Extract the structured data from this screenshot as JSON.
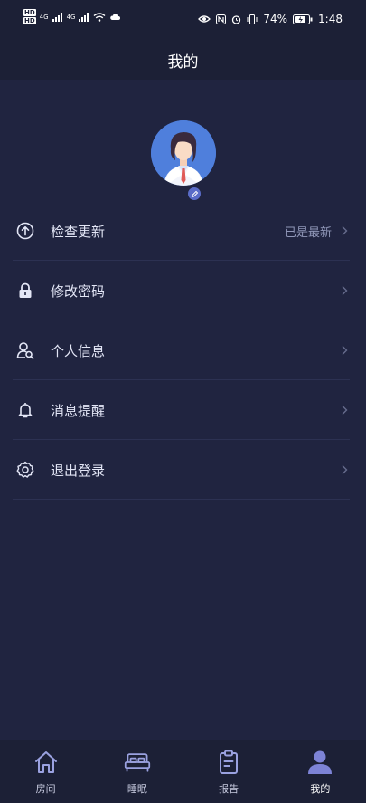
{
  "status_bar": {
    "hd1": "HD",
    "hd2": "HD",
    "net1": "4G",
    "net2": "4G",
    "battery": "74%",
    "time": "1:48"
  },
  "header": {
    "title": "我的"
  },
  "menu": {
    "items": [
      {
        "label": "检查更新",
        "extra": "已是最新",
        "icon": "arrow-up-circle-icon"
      },
      {
        "label": "修改密码",
        "extra": "",
        "icon": "lock-icon"
      },
      {
        "label": "个人信息",
        "extra": "",
        "icon": "person-search-icon"
      },
      {
        "label": "消息提醒",
        "extra": "",
        "icon": "bell-icon"
      },
      {
        "label": "退出登录",
        "extra": "",
        "icon": "gear-icon"
      }
    ]
  },
  "tabs": [
    {
      "label": "房间",
      "icon": "home-icon",
      "active": false
    },
    {
      "label": "睡眠",
      "icon": "bed-icon",
      "active": false
    },
    {
      "label": "报告",
      "icon": "clipboard-icon",
      "active": false
    },
    {
      "label": "我的",
      "icon": "user-icon",
      "active": true
    }
  ],
  "colors": {
    "background": "#202440",
    "bar": "#1c2036",
    "accent": "#7d83d6"
  }
}
